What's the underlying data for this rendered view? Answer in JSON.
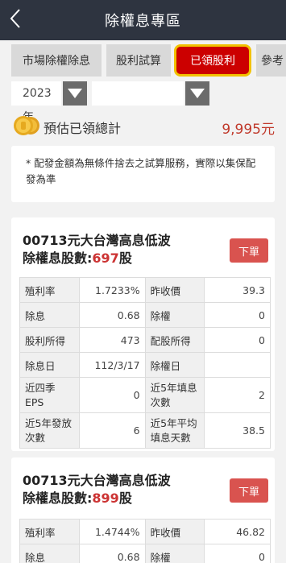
{
  "header": {
    "back_icon": "chevron-left-icon",
    "title": "除權息專區"
  },
  "tabs": [
    {
      "label": "市場除權除息",
      "active": false
    },
    {
      "label": "股利試算",
      "active": false
    },
    {
      "label": "已領股利",
      "active": true
    },
    {
      "label": "參考",
      "active": false
    }
  ],
  "filter": {
    "year": "2023年",
    "second": ""
  },
  "summary": {
    "label": "預估已領總計",
    "value": "9,995元"
  },
  "note": "* 配發金額為無條件捨去之試算服務，實際以集保配發為準",
  "cards": [
    {
      "name": "00713元大台灣高息低波",
      "shares_label": "除權息股數:",
      "shares": "697",
      "shares_unit": "股",
      "order": "下單",
      "rows": [
        [
          "殖利率",
          "1.7233%",
          "昨收價",
          "39.3"
        ],
        [
          "除息",
          "0.68",
          "除權",
          "0"
        ],
        [
          "股利所得",
          "473",
          "配股所得",
          "0"
        ],
        [
          "除息日",
          "112/3/17",
          "除權日",
          ""
        ],
        [
          "近四季EPS",
          "0",
          "近5年填息次數",
          "2"
        ],
        [
          "近5年發放次數",
          "6",
          "近5年平均填息天數",
          "38.5"
        ]
      ]
    },
    {
      "name": "00713元大台灣高息低波",
      "shares_label": "除權息股數:",
      "shares": "899",
      "shares_unit": "股",
      "order": "下單",
      "rows": [
        [
          "殖利率",
          "1.4744%",
          "昨收價",
          "46.82"
        ],
        [
          "除息",
          "0.68",
          "除權",
          "0"
        ]
      ]
    }
  ]
}
